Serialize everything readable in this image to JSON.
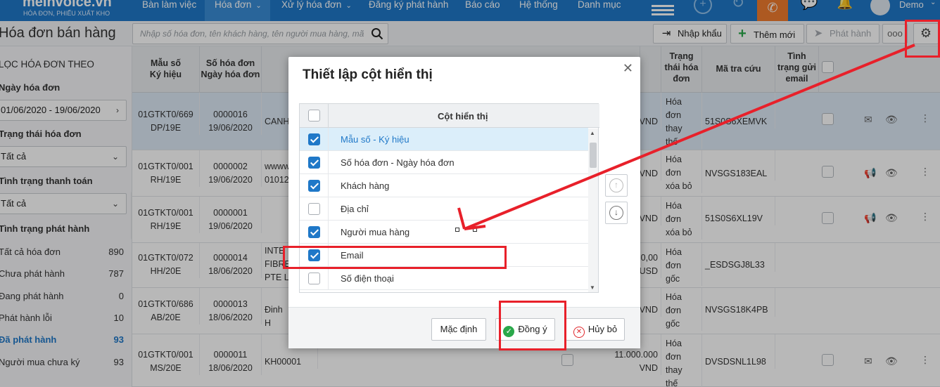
{
  "header": {
    "logo": "meInvoice.vn",
    "logo_tagline": "HÓA ĐƠN, PHIẾU XUẤT KHO",
    "nav": [
      {
        "label": "Bàn làm việc"
      },
      {
        "label": "Hóa đơn"
      },
      {
        "label": "Xử lý hóa đơn"
      },
      {
        "label": "Đăng ký phát hành"
      },
      {
        "label": "Báo cáo"
      },
      {
        "label": "Hệ thống"
      },
      {
        "label": "Danh mục"
      }
    ],
    "user": "Demo"
  },
  "toolbar": {
    "page_title": "Hóa đơn bán hàng",
    "search_placeholder": "Nhập số hóa đơn, tên khách hàng, tên người mua hàng, mã",
    "import_label": "Nhập khẩu",
    "add_label": "Thêm mới",
    "issue_label": "Phát hành",
    "more_label": "ooo"
  },
  "sidebar": {
    "heading": "LỌC HÓA ĐƠN THEO",
    "date_label": "Ngày hóa đơn",
    "date_value": "01/06/2020 - 19/06/2020",
    "status_label": "Trạng thái hóa đơn",
    "status_value": "Tất cả",
    "payment_label": "Tình trạng thanh toán",
    "payment_value": "Tất cả",
    "issue_label": "Tình trạng phát hành",
    "items": [
      {
        "label": "Tất cả hóa đơn",
        "count": "890"
      },
      {
        "label": "Chưa phát hành",
        "count": "787"
      },
      {
        "label": "Đang phát hành",
        "count": "0"
      },
      {
        "label": "Phát hành lỗi",
        "count": "10"
      },
      {
        "label": "Đã phát hành",
        "count": "93"
      },
      {
        "label": "Người mua chưa ký",
        "count": "93"
      }
    ]
  },
  "table": {
    "headers": {
      "form": "Mẫu số\nKý hiệu",
      "number": "Số hóa đơn\nNgày hóa đơn",
      "status": "Trạng\nthái hóa\nđơn",
      "lookup": "Mã tra cứu",
      "email_state": "Tình\ntrạng gửi\nemail"
    },
    "rows": [
      {
        "form": "01GTKT0/669\nDP/19E",
        "number": "0000016\n19/06/2020",
        "customer": "CANH",
        "amount": "VND",
        "status": "Hóa\nđơn\nthay\nthế",
        "lookup": "51S0S6XEMVK"
      },
      {
        "form": "01GTKT0/001\nRH/19E",
        "number": "0000002\n19/06/2020",
        "customer": "wwww\n01012",
        "amount": "VND",
        "status": "Hóa\nđơn\nxóa bỏ",
        "lookup": "NVSGS183EAL"
      },
      {
        "form": "01GTKT0/001\nRH/19E",
        "number": "0000001\n19/06/2020",
        "customer": "",
        "amount": "VND",
        "status": "Hóa\nđơn\nxóa bỏ",
        "lookup": "51S0S6XL19V"
      },
      {
        "form": "01GTKT0/072\nHH/20E",
        "number": "0000014\n18/06/2020",
        "customer": "INTE\nFIBRE\nPTE L",
        "amount": "0,00\nUSD",
        "status": "Hóa\nđơn\ngốc",
        "lookup": "_ESDSGJ8L33"
      },
      {
        "form": "01GTKT0/686\nAB/20E",
        "number": "0000013\n18/06/2020",
        "customer": "Đinh H",
        "amount": "VND",
        "status": "Hóa\nđơn\ngốc",
        "lookup": "NVSGS18K4PB"
      },
      {
        "form": "01GTKT0/001\nMS/20E",
        "number": "0000011\n18/06/2020",
        "customer": "KH00001",
        "amount": "11.000.000\nVND",
        "status": "Hóa\nđơn\nthay\nthế",
        "lookup": "DVSDSNL1L98"
      }
    ]
  },
  "dialog": {
    "title": "Thiết lập cột hiển thị",
    "column_header": "Cột hiển thị",
    "columns": [
      {
        "label": "Mẫu số - Ký hiệu",
        "checked": true
      },
      {
        "label": "Số hóa đơn - Ngày hóa đơn",
        "checked": true
      },
      {
        "label": "Khách hàng",
        "checked": true
      },
      {
        "label": "Địa chỉ",
        "checked": false
      },
      {
        "label": "Người mua hàng",
        "checked": true
      },
      {
        "label": "Email",
        "checked": true
      },
      {
        "label": "Số điện thoại",
        "checked": false
      }
    ],
    "default_label": "Mặc định",
    "ok_label": "Đồng ý",
    "cancel_label": "Hủy bỏ"
  },
  "colors": {
    "primary": "#1f78c8",
    "annotation": "#e8202a",
    "phone": "#f07c2e"
  }
}
